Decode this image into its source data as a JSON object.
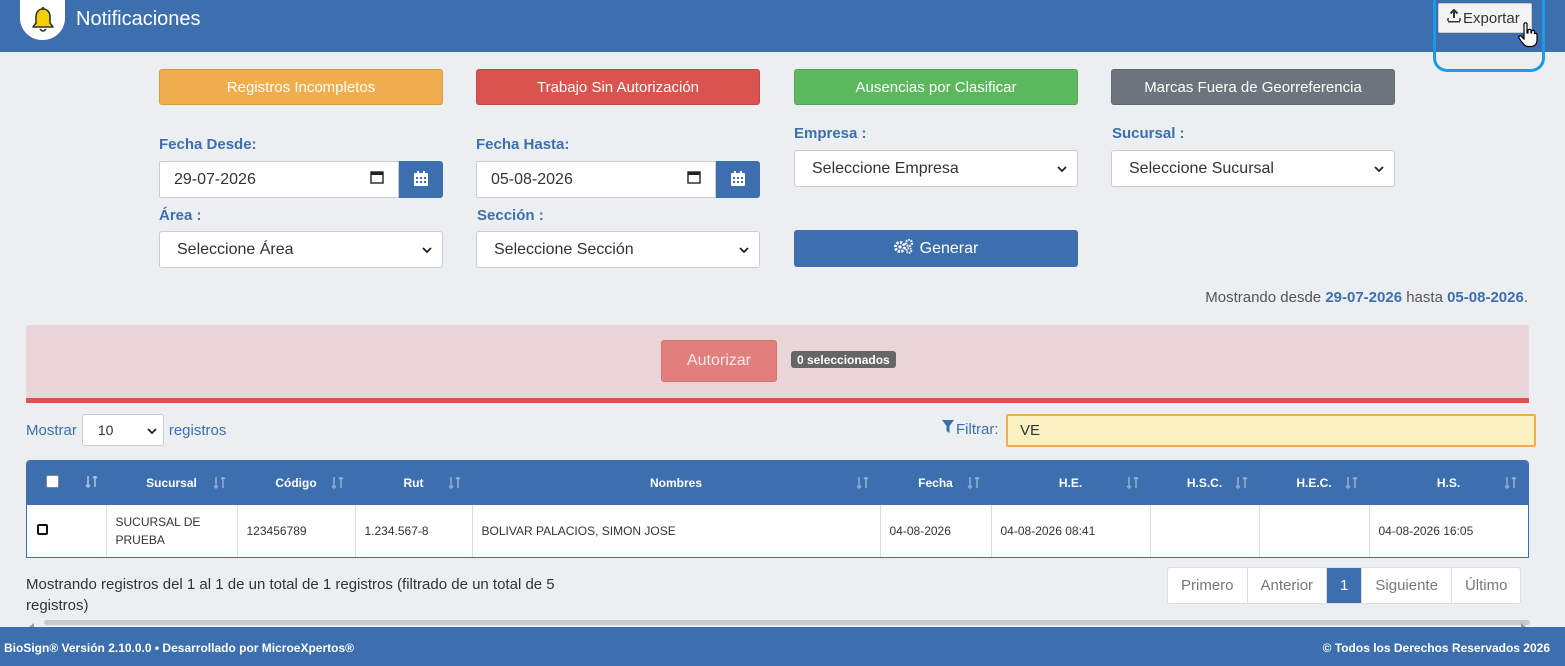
{
  "header": {
    "title": "Notificaciones",
    "export_label": "Exportar"
  },
  "top_buttons": {
    "incomplete": "Registros Incompletos",
    "unauthorized": "Trabajo Sin Autorización",
    "absences": "Ausencias por Clasificar",
    "geo": "Marcas Fuera de Georreferencia"
  },
  "filters": {
    "date_from_label": "Fecha Desde:",
    "date_from_value": "29-07-2026",
    "date_to_label": "Fecha Hasta:",
    "date_to_value": "05-08-2026",
    "company_label": "Empresa :",
    "company_value": "Seleccione Empresa",
    "branch_label": "Sucursal :",
    "branch_value": "Seleccione Sucursal",
    "area_label": "Área :",
    "area_value": "Seleccione Área",
    "section_label": "Sección :",
    "section_value": "Seleccione Sección",
    "generate_label": "Generar"
  },
  "range": {
    "prefix": "Mostrando desde",
    "from": "29-07-2026",
    "mid": "hasta",
    "to": "05-08-2026",
    "suffix": "."
  },
  "authorize": {
    "button": "Autorizar",
    "badge": "0 seleccionados"
  },
  "list_controls": {
    "show_label": "Mostrar",
    "page_length": "10",
    "records_label": "registros",
    "filter_label": "Filtrar:",
    "filter_value": "VE"
  },
  "table": {
    "columns": [
      "Sucursal",
      "Código",
      "Rut",
      "Nombres",
      "Fecha",
      "H.E.",
      "H.S.C.",
      "H.E.C.",
      "H.S."
    ],
    "rows": [
      {
        "sucursal": "SUCURSAL DE PRUEBA",
        "codigo": "123456789",
        "rut": "1.234.567-8",
        "nombres": "BOLIVAR PALACIOS, SIMON JOSE",
        "fecha": "04-08-2026",
        "he": "04-08-2026 08:41",
        "hsc": "",
        "hec": "",
        "hs": "04-08-2026 16:05"
      }
    ]
  },
  "info": "Mostrando registros del 1 al 1 de un total de 1 registros (filtrado de un total de 5 registros)",
  "pagination": {
    "first": "Primero",
    "prev": "Anterior",
    "current": "1",
    "next": "Siguiente",
    "last": "Último"
  },
  "footer": {
    "left": "BioSign® Versión 2.10.0.0 • Desarrollado por MicroeXpertos®",
    "right": "© Todos los Derechos Reservados 2026"
  },
  "colors": {
    "primary": "#3d6faf",
    "warning": "#f0ad4e",
    "danger": "#d9534f",
    "success": "#5cb85c",
    "secondary": "#6c757d"
  }
}
